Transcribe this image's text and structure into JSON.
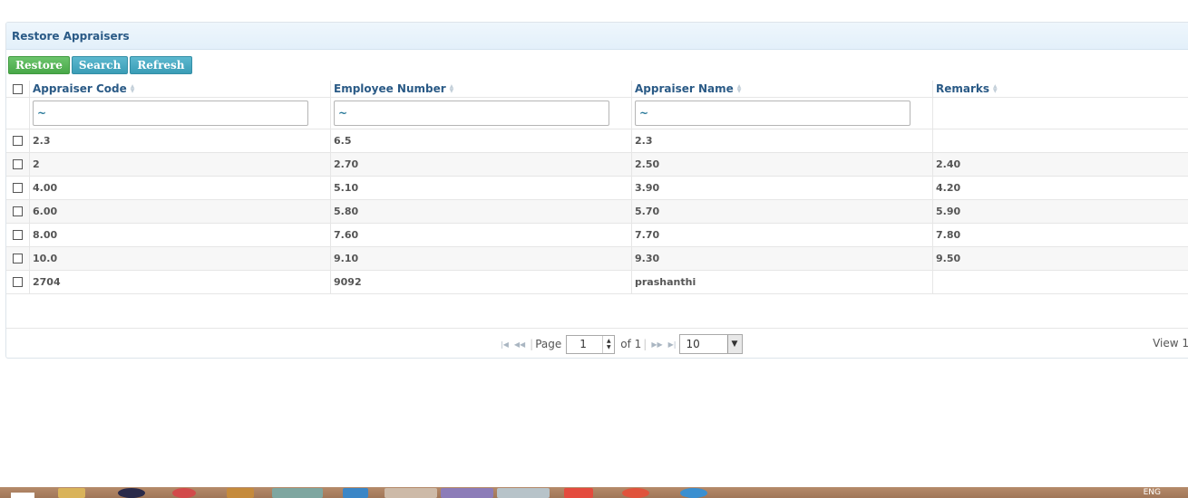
{
  "panel": {
    "title": "Restore Appraisers"
  },
  "toolbar": {
    "restore_label": "Restore",
    "search_label": "Search",
    "refresh_label": "Refresh"
  },
  "columns": [
    "Appraiser Code",
    "Employee Number",
    "Appraiser Name",
    "Remarks"
  ],
  "filters": {
    "code": "~",
    "employee_number": "~",
    "name": "~"
  },
  "rows": [
    [
      "2.3",
      "6.5",
      "2.3",
      ""
    ],
    [
      "2",
      "2.70",
      "2.50",
      "2.40"
    ],
    [
      "4.00",
      "5.10",
      "3.90",
      "4.20"
    ],
    [
      "6.00",
      "5.80",
      "5.70",
      "5.90"
    ],
    [
      "8.00",
      "7.60",
      "7.70",
      "7.80"
    ],
    [
      "10.0",
      "9.10",
      "9.30",
      "9.50"
    ],
    [
      "2704",
      "9092",
      "prashanthi",
      ""
    ]
  ],
  "pager": {
    "page_label": "Page",
    "page_value": "1",
    "of_label": "of 1",
    "page_size": "10",
    "view_label": "View 1"
  },
  "taskbar": {
    "lang": "ENG"
  }
}
